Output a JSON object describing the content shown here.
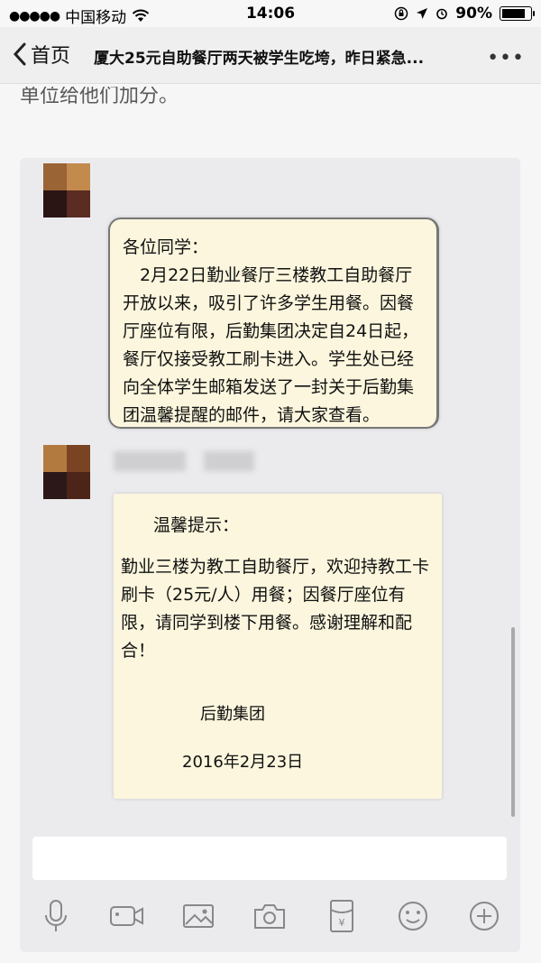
{
  "status_bar": {
    "carrier": "中国移动",
    "time": "14:06",
    "battery": "90%",
    "battery_level": 0.9
  },
  "nav": {
    "back_label": "首页",
    "title": "厦大25元自助餐厅两天被学生吃垮，昨日紧急..."
  },
  "article": {
    "partial_line": "单位给他们加分。"
  },
  "chat": {
    "message1": {
      "greeting": "各位同学：",
      "body": "2月22日勤业餐厅三楼教工自助餐厅开放以来，吸引了许多学生用餐。因餐厅座位有限，后勤集团决定自24日起，餐厅仅接受教工刷卡进入。学生处已经向全体学生邮箱发送了一封关于后勤集团温馨提醒的邮件，请大家查看。"
    },
    "message2": {
      "heading": "温馨提示：",
      "body": "勤业三楼为教工自助餐厅，欢迎持教工卡刷卡（25元/人）用餐；因餐厅座位有限，请同学到楼下用餐。感谢理解和配合！",
      "signature": "后勤集团",
      "date": "2016年2月23日"
    },
    "toolbar_icons": [
      "microphone-icon",
      "video-icon",
      "image-icon",
      "camera-icon",
      "red-packet-icon",
      "emoji-icon",
      "plus-icon"
    ]
  }
}
